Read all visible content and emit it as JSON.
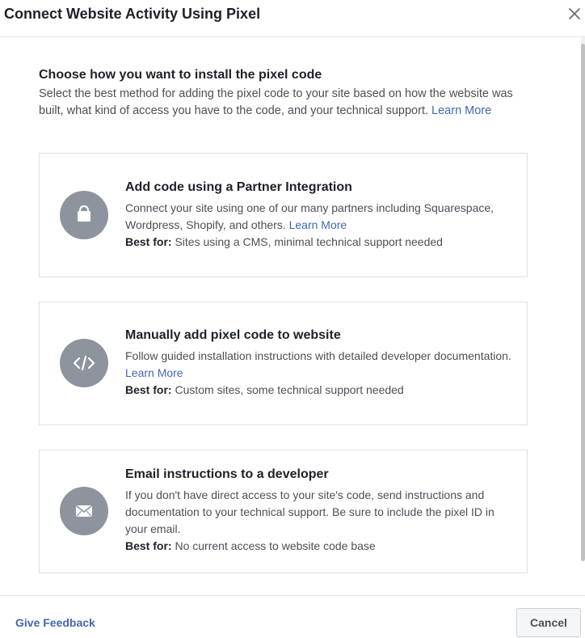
{
  "dialog": {
    "title": "Connect Website Activity Using Pixel",
    "close_icon": "close-icon"
  },
  "intro": {
    "heading": "Choose how you want to install the pixel code",
    "description": "Select the best method for adding the pixel code to your site based on how the website was built, what kind of access you have to the code, and your technical support.",
    "learn_more": "Learn More"
  },
  "options": [
    {
      "icon": "shopping-bag-icon",
      "title": "Add code using a Partner Integration",
      "description": "Connect your site using one of our many partners including Squarespace, Wordpress, Shopify, and others.",
      "learn_more": "Learn More",
      "best_for_label": "Best for:",
      "best_for_text": "Sites using a CMS, minimal technical support needed"
    },
    {
      "icon": "code-icon",
      "title": "Manually add pixel code to website",
      "description": "Follow guided installation instructions with detailed developer documentation.",
      "learn_more": "Learn More",
      "best_for_label": "Best for:",
      "best_for_text": "Custom sites, some technical support needed"
    },
    {
      "icon": "envelope-icon",
      "title": "Email instructions to a developer",
      "description": "If you don't have direct access to your site's code, send instructions and documentation to your technical support. Be sure to include the pixel ID in your email.",
      "best_for_label": "Best for:",
      "best_for_text": "No current access to website code base"
    }
  ],
  "footer": {
    "feedback": "Give Feedback",
    "cancel": "Cancel"
  },
  "colors": {
    "link": "#4267b2",
    "icon_circle": "#8d949e",
    "border": "#dddfe2"
  }
}
